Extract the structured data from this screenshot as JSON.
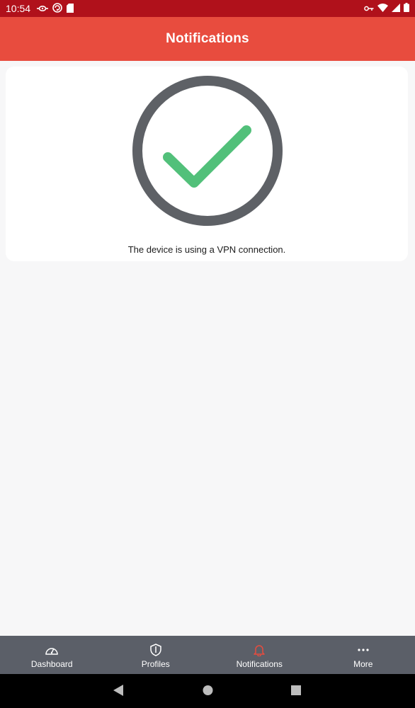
{
  "status_bar": {
    "time": "10:54",
    "left_icons": [
      "vpn-key-icon",
      "sync-icon",
      "sim-card-icon"
    ],
    "right_icons": [
      "key-icon",
      "wifi-icon",
      "signal-icon",
      "battery-icon"
    ]
  },
  "header": {
    "title": "Notifications"
  },
  "card": {
    "icon": "check-circle-icon",
    "message": "The device is using a VPN connection.",
    "colors": {
      "ring": "#5e6166",
      "check": "#52c07a"
    }
  },
  "bottom_nav": {
    "items": [
      {
        "label": "Dashboard",
        "icon": "speedometer-icon",
        "active": false
      },
      {
        "label": "Profiles",
        "icon": "shield-icon",
        "active": false
      },
      {
        "label": "Notifications",
        "icon": "bell-icon",
        "active": true
      },
      {
        "label": "More",
        "icon": "more-dots-icon",
        "active": false
      }
    ],
    "active_color": "#e84c3e"
  },
  "system_nav": {
    "buttons": [
      "back",
      "home",
      "recents"
    ]
  },
  "colors": {
    "status_bar": "#b0111b",
    "app_bar": "#e84c3e",
    "background": "#f7f7f8",
    "bottom_nav": "#5b5f68"
  }
}
